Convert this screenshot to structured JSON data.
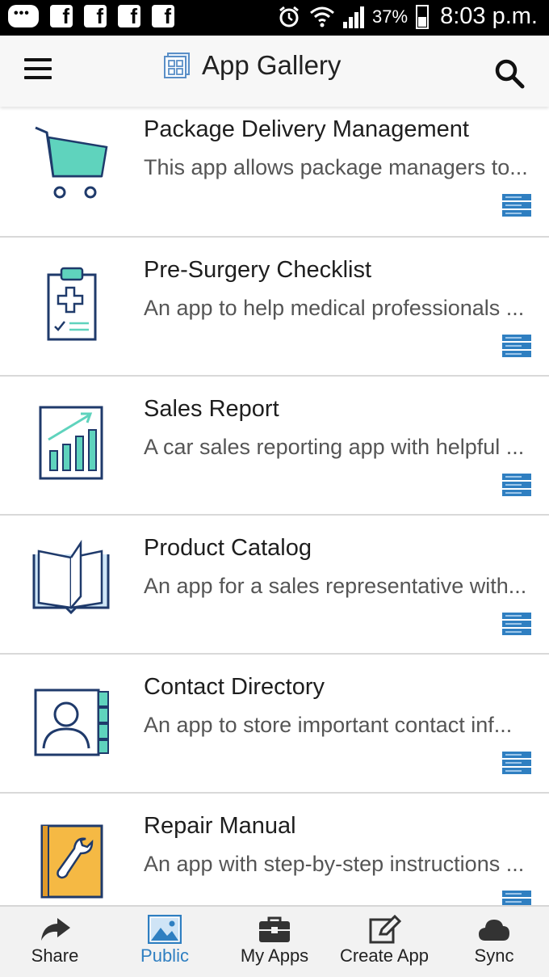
{
  "status_bar": {
    "battery_percent": "37%",
    "time": "8:03 p.m.",
    "icons": [
      "messages-icon",
      "facebook-icon",
      "facebook-icon",
      "facebook-icon",
      "facebook-icon",
      "alarm-icon",
      "wifi-icon",
      "signal-icon",
      "battery-icon"
    ]
  },
  "header": {
    "title": "App Gallery"
  },
  "apps": [
    {
      "name": "Package Delivery Management",
      "description": "This app allows package managers to...",
      "icon": "shopping-cart-icon"
    },
    {
      "name": "Pre-Surgery Checklist",
      "description": "An app to help medical professionals ...",
      "icon": "medical-clipboard-icon"
    },
    {
      "name": "Sales Report",
      "description": "A car sales reporting app with helpful ...",
      "icon": "bar-chart-icon"
    },
    {
      "name": "Product Catalog",
      "description": "An app for a sales representative with...",
      "icon": "open-book-icon"
    },
    {
      "name": "Contact Directory",
      "description": "An app to store important contact inf...",
      "icon": "contact-card-icon"
    },
    {
      "name": "Repair Manual",
      "description": "An app with step-by-step instructions ...",
      "icon": "wrench-book-icon"
    }
  ],
  "bottom_nav": {
    "share": "Share",
    "public": "Public",
    "my_apps": "My Apps",
    "create_app": "Create App",
    "sync": "Sync",
    "active": "Public"
  },
  "colors": {
    "teal": "#5fd3bd",
    "navy": "#1f3a6b",
    "blue": "#2f7fc1",
    "orange": "#f5b944"
  }
}
